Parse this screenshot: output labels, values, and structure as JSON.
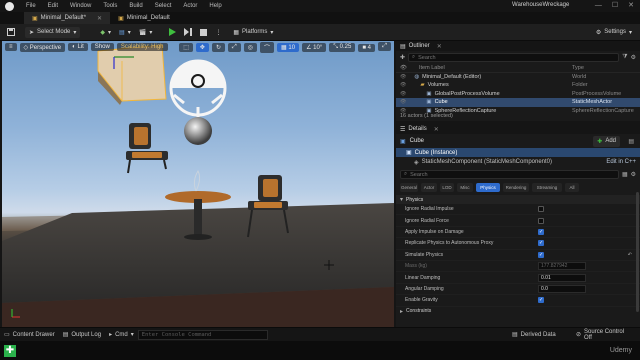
{
  "titlebar": {
    "menu": [
      "File",
      "Edit",
      "Window",
      "Tools",
      "Build",
      "Select",
      "Actor",
      "Help"
    ],
    "project_name": "WarehouseWreckage"
  },
  "tabs": [
    {
      "label": "Minimal_Default*",
      "active": true
    },
    {
      "label": "Minimal_Default",
      "active": false
    }
  ],
  "toolbar": {
    "select_mode": "Select Mode",
    "platforms": "Platforms",
    "settings": "Settings"
  },
  "viewport": {
    "perspective": "Perspective",
    "lit": "Lit",
    "show": "Show",
    "scalability": "Scalability: High",
    "grid_size": "10",
    "rotation_snap": "10°",
    "scale_snap": "0.25",
    "camera_speed": "4"
  },
  "outliner": {
    "title": "Outliner",
    "search_placeholder": "Search",
    "col_label": "Item Label",
    "col_type": "Type",
    "rows": [
      {
        "label": "Minimal_Default (Editor)",
        "type": "World",
        "indent": 0
      },
      {
        "label": "Volumes",
        "type": "Folder",
        "indent": 1
      },
      {
        "label": "GlobalPostProcessVolume",
        "type": "PostProcessVolume",
        "indent": 2
      },
      {
        "label": "Cube",
        "type": "StaticMeshActor",
        "indent": 2,
        "selected": true
      },
      {
        "label": "SphereReflectionCapture",
        "type": "SphereReflectionCapture",
        "indent": 2
      }
    ],
    "status": "16 actors (1 selected)"
  },
  "details": {
    "title": "Details",
    "object_name": "Cube",
    "add_label": "Add",
    "instance": "Cube (Instance)",
    "component": "StaticMeshComponent (StaticMeshComponent0)",
    "edit_cpp": "Edit in C++",
    "search_placeholder": "Search",
    "categories": [
      "General",
      "Actor",
      "LOD",
      "Misc",
      "Physics",
      "Rendering",
      "Streaming",
      "All"
    ],
    "active_category": "Physics",
    "section": "Physics",
    "properties": [
      {
        "label": "Ignore Radial Impulse",
        "kind": "check",
        "on": false
      },
      {
        "label": "Ignore Radial Force",
        "kind": "check",
        "on": false
      },
      {
        "label": "Apply Impulse on Damage",
        "kind": "check",
        "on": true
      },
      {
        "label": "Replicate Physics to Autonomous Proxy",
        "kind": "check",
        "on": true
      },
      {
        "label": "Simulate Physics",
        "kind": "check",
        "on": true
      },
      {
        "label": "Mass (kg)",
        "kind": "num",
        "value": "177.827942",
        "dim": true
      },
      {
        "label": "Linear Damping",
        "kind": "num",
        "value": "0.01"
      },
      {
        "label": "Angular Damping",
        "kind": "num",
        "value": "0.0"
      },
      {
        "label": "Enable Gravity",
        "kind": "check",
        "on": true
      }
    ],
    "next_section": "Constraints"
  },
  "bottombar": {
    "content_drawer": "Content Drawer",
    "output_log": "Output Log",
    "cmd": "Cmd",
    "console_placeholder": "Enter Console Command",
    "derived_data": "Derived Data",
    "source_control": "Source Control Off"
  },
  "watermark": "Udemy",
  "colors": {
    "accent": "#2e6bcc",
    "play_green": "#3fbf3f",
    "selection": "#314a6e"
  }
}
